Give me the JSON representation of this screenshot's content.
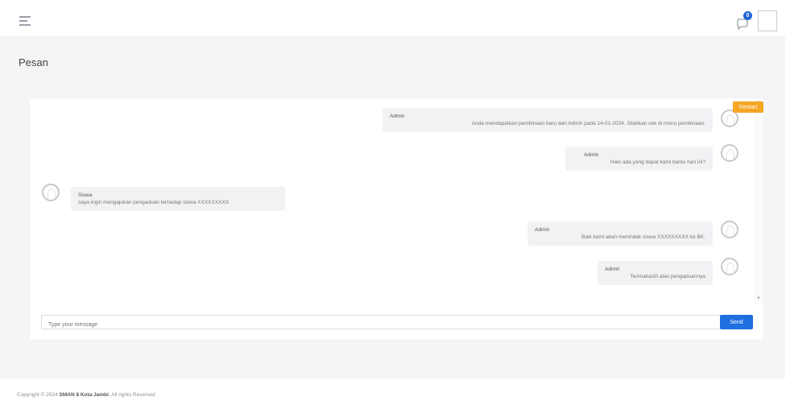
{
  "header": {
    "menu_icon": "hamburger-icon",
    "notification_icon": "chat-bubble-icon",
    "notification_count": "0"
  },
  "page": {
    "title": "Pesan",
    "reset_label": "Restart"
  },
  "messages": [
    {
      "side": "right",
      "name": "Admin",
      "text": "Anda mendapatkan pembinaan baru dari Admin pada 14-01-2024. Silahkan cek di menu pembinaan."
    },
    {
      "side": "right",
      "name": "Admin",
      "text": "Halo ada yang dapat kami bantu hari ini?"
    },
    {
      "side": "left",
      "name": "Siswa",
      "text": "saya ingin mengajukan pengaduan terhadap siswa XXXXXXXXX"
    },
    {
      "side": "right",
      "name": "Admin",
      "text": "Baik kami akan menindak siswa XXXXXXXXX ke BK."
    },
    {
      "side": "right",
      "name": "Admin",
      "text": "Terimakasih atas pengaduannya"
    }
  ],
  "composer": {
    "placeholder": "Type your message",
    "send_label": "Send"
  },
  "footer": {
    "prefix": "Copyright © 2024 ",
    "brand": "SMAN 8 Kota Jambi",
    "suffix": ". All rights Reserved"
  },
  "colors": {
    "accent": "#1e6fe0",
    "reset": "#f5a623"
  }
}
